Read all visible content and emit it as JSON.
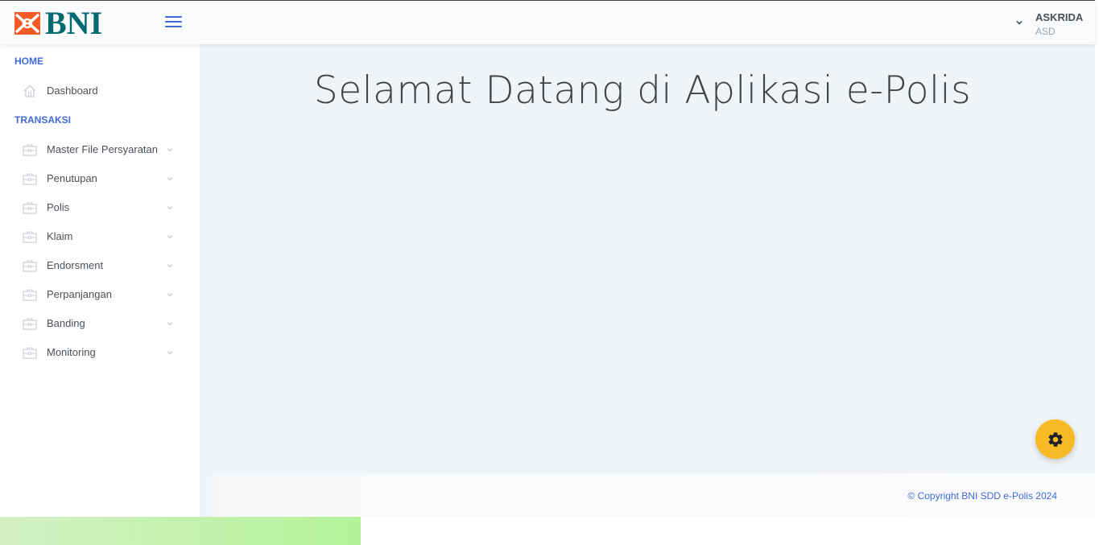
{
  "brand": {
    "name": "BNI",
    "colors": {
      "orange": "#f15a22",
      "teal": "#006a70"
    }
  },
  "header": {
    "menu_icon": "hamburger-icon",
    "user": {
      "name": "ASKRIDA",
      "role": "ASD",
      "chevron_icon": "chevron-down-icon"
    }
  },
  "sidebar": {
    "sections": [
      {
        "heading": "HOME"
      },
      {
        "heading": "TRANSAKSI"
      }
    ],
    "home_items": [
      {
        "label": "Dashboard",
        "icon": "home-icon"
      }
    ],
    "transaksi_items": [
      {
        "label": "Master File Persyaratan",
        "icon": "briefcase-icon"
      },
      {
        "label": "Penutupan",
        "icon": "briefcase-icon"
      },
      {
        "label": "Polis",
        "icon": "briefcase-icon"
      },
      {
        "label": "Klaim",
        "icon": "briefcase-icon"
      },
      {
        "label": "Endorsment",
        "icon": "briefcase-icon"
      },
      {
        "label": "Perpanjangan",
        "icon": "briefcase-icon"
      },
      {
        "label": "Banding",
        "icon": "briefcase-icon"
      },
      {
        "label": "Monitoring",
        "icon": "briefcase-icon"
      }
    ],
    "accent_color": "#3f6ad8"
  },
  "main": {
    "welcome": "Selamat Datang di Aplikasi e-Polis"
  },
  "footer": {
    "copyright": "© Copyright BNI SDD e-Polis 2024"
  },
  "settings_button": {
    "icon": "gear-icon",
    "color": "#f7b924"
  }
}
